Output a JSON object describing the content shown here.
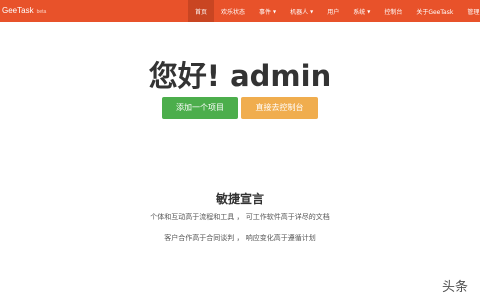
{
  "navbar": {
    "brand": "GeeTask",
    "brand_tag": "beta",
    "items": [
      {
        "label": "首页",
        "active": true,
        "dropdown": false
      },
      {
        "label": "欢乐状态",
        "active": false,
        "dropdown": false
      },
      {
        "label": "事件",
        "active": false,
        "dropdown": true
      },
      {
        "label": "机器人",
        "active": false,
        "dropdown": true
      },
      {
        "label": "用户",
        "active": false,
        "dropdown": false
      },
      {
        "label": "系统",
        "active": false,
        "dropdown": true
      },
      {
        "label": "控制台",
        "active": false,
        "dropdown": false
      },
      {
        "label": "关于GeeTask",
        "active": false,
        "dropdown": false
      },
      {
        "label": "管理员",
        "active": false,
        "dropdown": false
      }
    ]
  },
  "hero": {
    "greeting": "您好! admin",
    "add_project_label": "添加一个项目",
    "console_label": "直接去控制台"
  },
  "manifesto": {
    "title": "敏捷宣言",
    "line1": "个体和互动高于流程和工具 ， 可工作软件高于详尽的文档",
    "line2": "客户合作高于合同谈判 ， 响应变化高于遵循计划"
  },
  "watermark": "头条",
  "colors": {
    "navbar": "#e8522a",
    "navbar_active": "#c94522",
    "success": "#4cae4c",
    "warning": "#f0ad4e"
  }
}
